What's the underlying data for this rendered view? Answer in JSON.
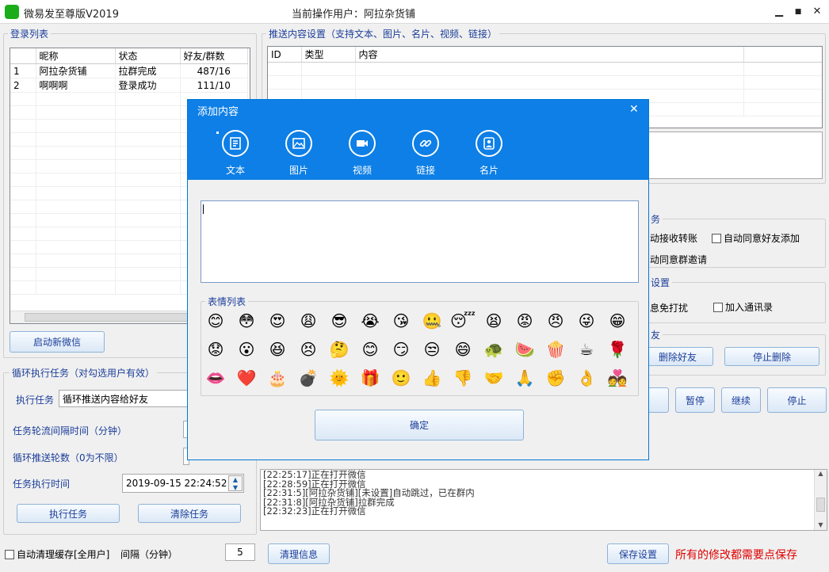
{
  "window": {
    "title": "微易发至尊版V2019",
    "current_user": "当前操作用户：阿拉杂货铺",
    "minimize": "▁",
    "maximize": "■",
    "close": "✕"
  },
  "login_list": {
    "label": "登录列表",
    "columns": [
      "昵称",
      "状态",
      "好友/群数"
    ],
    "rows": [
      {
        "idx": "1",
        "nick": "阿拉杂货铺",
        "status": "拉群完成",
        "count": "487/16"
      },
      {
        "idx": "2",
        "nick": "啊啊啊",
        "status": "登录成功",
        "count": "111/10"
      }
    ],
    "start_button": "启动新微信"
  },
  "cycle_task": {
    "label": "循环执行任务（对勾选用户有效）",
    "task_label": "执行任务",
    "task_value": "循环推送内容给好友",
    "interval_label": "任务轮流间隔时间（分钟）",
    "rounds_label": "循环推送轮数（0为不限）",
    "time_label": "任务执行时间",
    "time_value": "2019-09-15 22:24:52",
    "exec_button": "执行任务",
    "clear_button": "清除任务"
  },
  "bottom": {
    "auto_clean": "自动清理缓存[全用户]",
    "interval_label": "间隔（分钟）",
    "interval_value": "5",
    "clear_info": "清理信息",
    "save_settings": "保存设置",
    "warning": "所有的修改都需要点保存"
  },
  "push": {
    "label": "推送内容设置（支持文本、图片、名片、视频、链接）",
    "columns": [
      "ID",
      "类型",
      "内容"
    ]
  },
  "right_options": {
    "auto_receive": "动接收转账",
    "auto_add_friend": "自动同意好友添加",
    "auto_group": "动同意群邀请",
    "settings_tail": "设置",
    "dnd": "息免打扰",
    "add_contacts": "加入通讯录",
    "friend_tail": "友",
    "delete_friend": "删除好友",
    "stop_delete": "停止删除",
    "task_tail": "务",
    "pause": "暂停",
    "resume": "继续",
    "stop": "停止"
  },
  "log": [
    "[22:25:17]正在打开微信",
    "[22:28:59]正在打开微信",
    "[22:31:5][阿拉杂货铺][未设置]自动跳过，已在群内",
    "[22:31:8][阿拉杂货铺]拉群完成",
    "[22:32:23]正在打开微信"
  ],
  "modal": {
    "title": "添加内容",
    "close": "✕",
    "tools": [
      "文本",
      "图片",
      "视频",
      "链接",
      "名片"
    ],
    "emoji_label": "表情列表",
    "confirm": "确定"
  },
  "emojis": [
    "😊",
    "😳",
    "😍",
    "😩",
    "😎",
    "😭",
    "😘",
    "🤐",
    "😴",
    "😫",
    "😡",
    "😠",
    "😜",
    "😁",
    "😟",
    "😮",
    "😆",
    "😣",
    "🤔",
    "😊",
    "😏",
    "😒",
    "😄",
    "🐢",
    "🍉",
    "🍿",
    "☕",
    "🌹",
    "👄",
    "❤️",
    "🎂",
    "💣",
    "🌞",
    "🎁",
    "🙂",
    "👍",
    "👎",
    "🤝",
    "🙏",
    "✊",
    "👌",
    "💑"
  ],
  "colors": {
    "accent": "#0d7fe6",
    "label": "#1c3e9a",
    "warning": "#e00000"
  }
}
